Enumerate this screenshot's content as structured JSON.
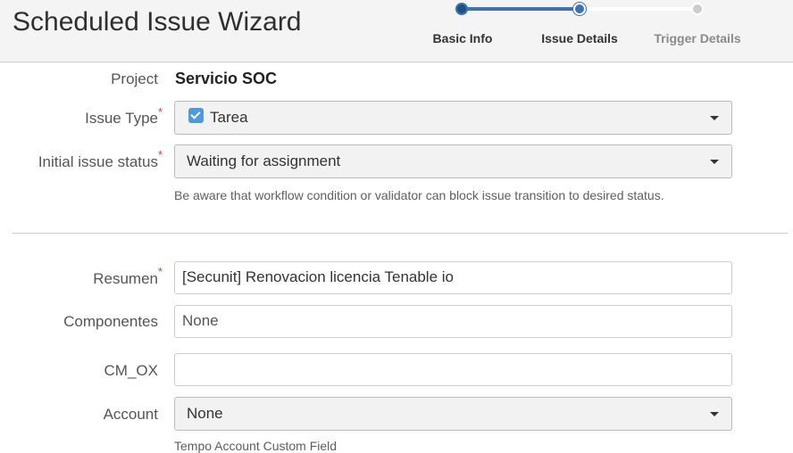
{
  "header": {
    "title": "Scheduled Issue Wizard",
    "steps": [
      {
        "label": "Basic Info",
        "state": "done"
      },
      {
        "label": "Issue Details",
        "state": "current"
      },
      {
        "label": "Trigger Details",
        "state": "todo"
      }
    ]
  },
  "form": {
    "project": {
      "label": "Project",
      "value": "Servicio SOC"
    },
    "issue_type": {
      "label": "Issue Type",
      "required": "*",
      "value": "Tarea",
      "icon": "task-checkbox-icon"
    },
    "initial_status": {
      "label": "Initial issue status",
      "required": "*",
      "value": "Waiting for assignment",
      "hint": "Be aware that workflow condition or validator can block issue transition to desired status."
    },
    "summary": {
      "label": "Resumen",
      "required": "*",
      "value": "[Secunit] Renovacion licencia Tenable io"
    },
    "components": {
      "label": "Componentes",
      "value": "None"
    },
    "cm_ox": {
      "label": "CM_OX",
      "value": ""
    },
    "account": {
      "label": "Account",
      "value": "None",
      "hint": "Tempo Account Custom Field"
    }
  },
  "colors": {
    "accent": "#3b73af",
    "required": "#d04437",
    "header_bg": "#f4f4f4"
  }
}
